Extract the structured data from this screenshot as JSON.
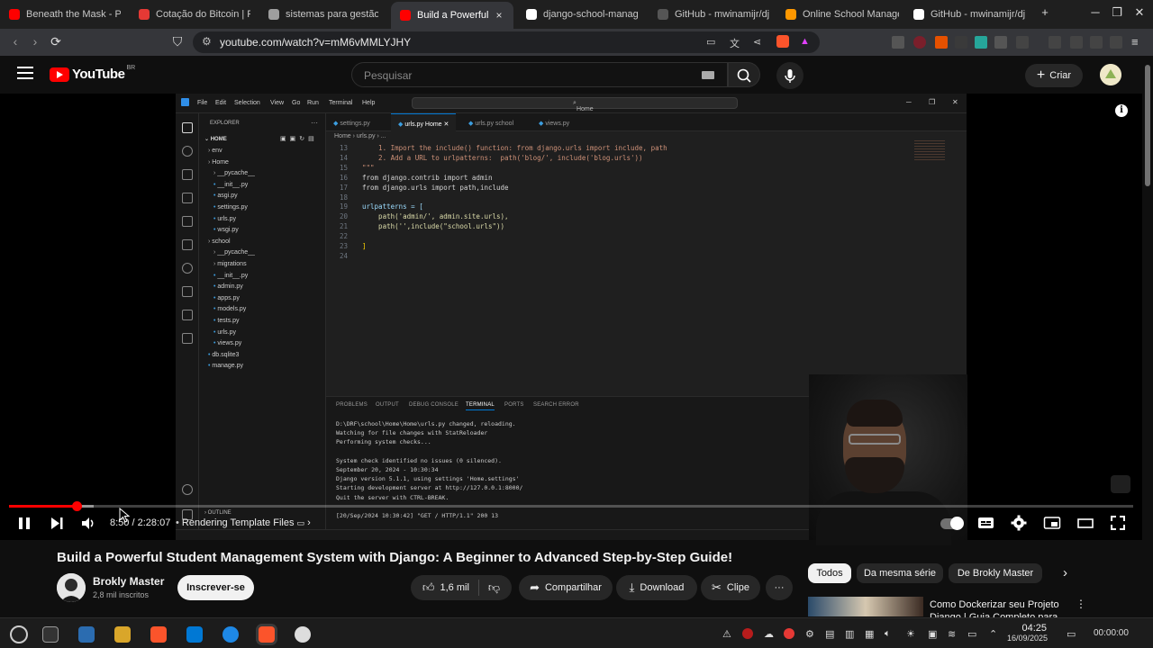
{
  "browser": {
    "tabs": [
      {
        "label": "Beneath the Mask - Pe",
        "color": "#ff0000"
      },
      {
        "label": "Cotação do Bitcoin | P",
        "color": "#e53935"
      },
      {
        "label": "sistemas para gestão",
        "color": "#9e9e9e"
      },
      {
        "label": "Build a Powerful",
        "color": "#ff0000",
        "active": true
      },
      {
        "label": "django-school-manag",
        "color": "#ffffff"
      },
      {
        "label": "GitHub - mwinamijr/dj",
        "color": "#555555"
      },
      {
        "label": "Online School Manage",
        "color": "#ff9800"
      },
      {
        "label": "GitHub - mwinamijr/dj",
        "color": "#ffffff"
      }
    ],
    "new_tab": "+",
    "tab_close": "×",
    "url": "youtube.com/watch?v=mM6vMMLYJHY",
    "window_controls": {
      "minimize": "─",
      "maximize": "❐",
      "close": "✕"
    }
  },
  "youtube": {
    "logo_text": "YouTube",
    "country_code": "BR",
    "search_placeholder": "Pesquisar",
    "create_label": "Criar",
    "info_icon": "i"
  },
  "video": {
    "title": "Build a Powerful Student Management System with Django: A Beginner to Advanced Step-by-Step Guide!",
    "time_current": "8:50",
    "time_total": "2:28:07",
    "time_separator": "/",
    "chapter": "Rendering Template Files",
    "progress_fraction": 0.0597,
    "buffer_fraction": 0.075,
    "channel": {
      "name": "Brokly Master",
      "subscribers": "2,8 mil inscritos"
    },
    "subscribe_label": "Inscrever-se",
    "likes": "1,6 mil",
    "share_label": "Compartilhar",
    "download_label": "Download",
    "clip_label": "Clipe",
    "more_label": "···"
  },
  "vscode": {
    "menu": [
      "File",
      "Edit",
      "Selection",
      "View",
      "Go",
      "Run",
      "Terminal",
      "Help"
    ],
    "command_center": "Home",
    "explorer_title": "EXPLORER",
    "workspace": "HOME",
    "tree": [
      {
        "label": "env",
        "level": 1,
        "type": "folder"
      },
      {
        "label": "Home",
        "level": 1,
        "type": "folder"
      },
      {
        "label": "__pycache__",
        "level": 2,
        "type": "folder"
      },
      {
        "label": "__init__.py",
        "level": 2,
        "type": "file"
      },
      {
        "label": "asgi.py",
        "level": 2,
        "type": "file"
      },
      {
        "label": "settings.py",
        "level": 2,
        "type": "file"
      },
      {
        "label": "urls.py",
        "level": 2,
        "type": "file"
      },
      {
        "label": "wsgi.py",
        "level": 2,
        "type": "file"
      },
      {
        "label": "school",
        "level": 1,
        "type": "folder"
      },
      {
        "label": "__pycache__",
        "level": 2,
        "type": "folder"
      },
      {
        "label": "migrations",
        "level": 2,
        "type": "folder"
      },
      {
        "label": "__init__.py",
        "level": 2,
        "type": "file"
      },
      {
        "label": "admin.py",
        "level": 2,
        "type": "file"
      },
      {
        "label": "apps.py",
        "level": 2,
        "type": "file"
      },
      {
        "label": "models.py",
        "level": 2,
        "type": "file"
      },
      {
        "label": "tests.py",
        "level": 2,
        "type": "file"
      },
      {
        "label": "urls.py",
        "level": 2,
        "type": "file"
      },
      {
        "label": "views.py",
        "level": 2,
        "type": "file"
      },
      {
        "label": "db.sqlite3",
        "level": 1,
        "type": "file"
      },
      {
        "label": "manage.py",
        "level": 1,
        "type": "file"
      }
    ],
    "outline_label": "OUTLINE",
    "editor_tabs": [
      {
        "label": "settings.py"
      },
      {
        "label": "urls.py Home",
        "active": true
      },
      {
        "label": "urls.py school"
      },
      {
        "label": "views.py"
      }
    ],
    "breadcrumb": "Home  ›  urls.py  ›  ...",
    "code": [
      {
        "n": "13",
        "text": "    1. Import the include() function: from django.urls import include, path",
        "cls": "c-com"
      },
      {
        "n": "14",
        "text": "    2. Add a URL to urlpatterns:  path('blog/', include('blog.urls'))",
        "cls": "c-com"
      },
      {
        "n": "15",
        "text": "\"\"\"",
        "cls": "c-com"
      },
      {
        "n": "16",
        "text": "from django.contrib import admin",
        "cls": "c-def"
      },
      {
        "n": "17",
        "text": "from django.urls import path,include",
        "cls": "c-def"
      },
      {
        "n": "18",
        "text": "",
        "cls": "c-def"
      },
      {
        "n": "19",
        "text": "urlpatterns = [",
        "cls": "c-var"
      },
      {
        "n": "20",
        "text": "    path('admin/', admin.site.urls),",
        "cls": "c-fn"
      },
      {
        "n": "21",
        "text": "    path('',include(\"school.urls\"))",
        "cls": "c-fn"
      },
      {
        "n": "22",
        "text": "",
        "cls": "c-def"
      },
      {
        "n": "23",
        "text": "]",
        "cls": "c-br"
      },
      {
        "n": "24",
        "text": "",
        "cls": "c-def"
      }
    ],
    "panel_tabs": [
      "PROBLEMS",
      "OUTPUT",
      "DEBUG CONSOLE",
      "TERMINAL",
      "PORTS",
      "SEARCH ERROR"
    ],
    "terminal": [
      "D:\\DRF\\school\\Home\\Home\\urls.py changed, reloading.",
      "Watching for file changes with StatReloader",
      "Performing system checks...",
      "",
      "System check identified no issues (0 silenced).",
      "September 20, 2024 - 10:30:34",
      "Django version 5.1.1, using settings 'Home.settings'",
      "Starting development server at http://127.0.0.1:8000/",
      "Quit the server with CTRL-BREAK.",
      "",
      "[20/Sep/2024 10:30:42] \"GET / HTTP/1.1\" 200 13"
    ]
  },
  "recommendations": {
    "chips": [
      "Todos",
      "Da mesma série",
      "De Brokly Master"
    ],
    "first_title": "Como Dockerizar seu Projeto Django | Guia Completo para"
  },
  "taskbar": {
    "time": "04:25",
    "date": "16/09/2025",
    "clock": "00:00:00"
  },
  "colors": {
    "yt_red": "#ff0000",
    "background": "#0f0f0f",
    "pill": "#272727"
  }
}
